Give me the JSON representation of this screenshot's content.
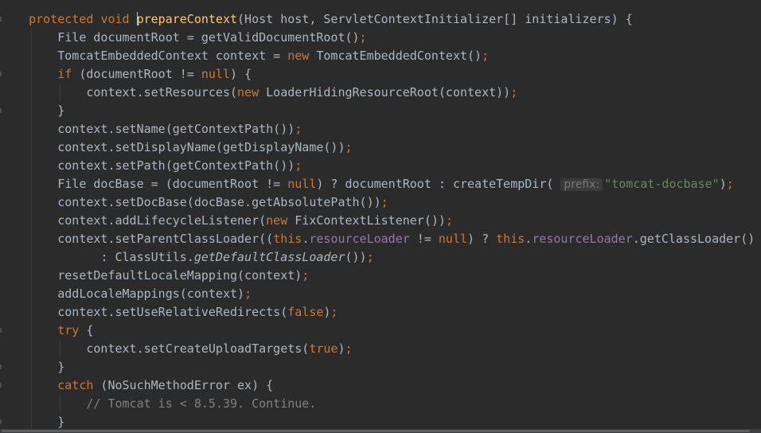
{
  "editor": {
    "lines": [
      {
        "indent": 1,
        "tokens": [
          {
            "t": "protected",
            "c": "kw"
          },
          {
            "t": " "
          },
          {
            "t": "void",
            "c": "kw"
          },
          {
            "t": " "
          },
          {
            "caret": true
          },
          {
            "t": "prepareContext",
            "c": "fn"
          },
          {
            "t": "(Host host, ServletContextInitializer[] initializers) {"
          }
        ]
      },
      {
        "indent": 2,
        "tokens": [
          {
            "t": "File documentRoot = getValidDocumentRoot()"
          },
          {
            "t": ";",
            "c": "kw"
          }
        ]
      },
      {
        "indent": 2,
        "tokens": [
          {
            "t": "TomcatEmbeddedContext context = "
          },
          {
            "t": "new",
            "c": "kw"
          },
          {
            "t": " TomcatEmbeddedContext()"
          },
          {
            "t": ";",
            "c": "kw"
          }
        ]
      },
      {
        "indent": 2,
        "tokens": [
          {
            "t": "if",
            "c": "kw"
          },
          {
            "t": " (documentRoot != "
          },
          {
            "t": "null",
            "c": "kw"
          },
          {
            "t": ") {"
          }
        ]
      },
      {
        "indent": 3,
        "tokens": [
          {
            "t": "context.setResources("
          },
          {
            "t": "new",
            "c": "kw"
          },
          {
            "t": " LoaderHidingResourceRoot(context))"
          },
          {
            "t": ";",
            "c": "kw"
          }
        ]
      },
      {
        "indent": 2,
        "tokens": [
          {
            "t": "}"
          }
        ]
      },
      {
        "indent": 2,
        "tokens": [
          {
            "t": "context.setName(getContextPath())"
          },
          {
            "t": ";",
            "c": "kw"
          }
        ]
      },
      {
        "indent": 2,
        "tokens": [
          {
            "t": "context.setDisplayName(getDisplayName())"
          },
          {
            "t": ";",
            "c": "kw"
          }
        ]
      },
      {
        "indent": 2,
        "tokens": [
          {
            "t": "context.setPath(getContextPath())"
          },
          {
            "t": ";",
            "c": "kw"
          }
        ]
      },
      {
        "indent": 2,
        "tokens": [
          {
            "t": "File docBase = (documentRoot != "
          },
          {
            "t": "null",
            "c": "kw"
          },
          {
            "t": ") ? documentRoot : createTempDir( "
          },
          {
            "t": "prefix:",
            "c": "hint"
          },
          {
            "t": "\"tomcat-docbase\"",
            "c": "str"
          },
          {
            "t": ")"
          },
          {
            "t": ";",
            "c": "kw"
          }
        ]
      },
      {
        "indent": 2,
        "tokens": [
          {
            "t": "context.setDocBase(docBase.getAbsolutePath())"
          },
          {
            "t": ";",
            "c": "kw"
          }
        ]
      },
      {
        "indent": 2,
        "tokens": [
          {
            "t": "context.addLifecycleListener("
          },
          {
            "t": "new",
            "c": "kw"
          },
          {
            "t": " FixContextListener())"
          },
          {
            "t": ";",
            "c": "kw"
          }
        ]
      },
      {
        "indent": 2,
        "tokens": [
          {
            "t": "context.setParentClassLoader(("
          },
          {
            "t": "this",
            "c": "kw"
          },
          {
            "t": "."
          },
          {
            "t": "resourceLoader",
            "c": "field"
          },
          {
            "t": " != "
          },
          {
            "t": "null",
            "c": "kw"
          },
          {
            "t": ") ? "
          },
          {
            "t": "this",
            "c": "kw"
          },
          {
            "t": "."
          },
          {
            "t": "resourceLoader",
            "c": "field"
          },
          {
            "t": ".getClassLoader()"
          }
        ]
      },
      {
        "indent": 2,
        "extra": "      ",
        "tokens": [
          {
            "t": ": ClassUtils."
          },
          {
            "t": "getDefaultClassLoader",
            "c": "italic"
          },
          {
            "t": "())"
          },
          {
            "t": ";",
            "c": "kw"
          }
        ]
      },
      {
        "indent": 2,
        "tokens": [
          {
            "t": "resetDefaultLocaleMapping(context)"
          },
          {
            "t": ";",
            "c": "kw"
          }
        ]
      },
      {
        "indent": 2,
        "tokens": [
          {
            "t": "addLocaleMappings(context)"
          },
          {
            "t": ";",
            "c": "kw"
          }
        ]
      },
      {
        "indent": 2,
        "tokens": [
          {
            "t": "context.setUseRelativeRedirects("
          },
          {
            "t": "false",
            "c": "kw"
          },
          {
            "t": ")"
          },
          {
            "t": ";",
            "c": "kw"
          }
        ]
      },
      {
        "indent": 2,
        "tokens": [
          {
            "t": "try",
            "c": "kw"
          },
          {
            "t": " {"
          }
        ]
      },
      {
        "indent": 3,
        "tokens": [
          {
            "t": "context.setCreateUploadTargets("
          },
          {
            "t": "true",
            "c": "kw"
          },
          {
            "t": ")"
          },
          {
            "t": ";",
            "c": "kw"
          }
        ]
      },
      {
        "indent": 2,
        "tokens": [
          {
            "t": "}"
          }
        ]
      },
      {
        "indent": 2,
        "tokens": [
          {
            "t": "catch",
            "c": "kw"
          },
          {
            "t": " (NoSuchMethodError ex) {"
          }
        ]
      },
      {
        "indent": 3,
        "tokens": [
          {
            "t": "// Tomcat is < 8.5.39. Continue.",
            "c": "comment"
          }
        ]
      },
      {
        "indent": 2,
        "tokens": [
          {
            "t": "}"
          }
        ]
      }
    ]
  },
  "colors": {
    "background": "#2b2b2b",
    "text": "#a9b7c6",
    "keyword": "#cc7832",
    "method": "#ffc66d",
    "field": "#9876aa",
    "string": "#6a8759",
    "comment": "#808080",
    "hint": "#787878"
  }
}
